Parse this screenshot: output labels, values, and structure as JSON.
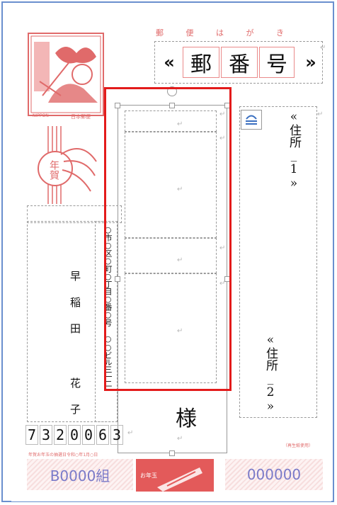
{
  "header": {
    "postcard_kana": "郵 便 は が き",
    "zip_left": "«",
    "zip_chars": [
      "郵",
      "番",
      "号"
    ],
    "zip_right": "»"
  },
  "stamp": {
    "caption_left": "NIPPON",
    "caption_right": "日本郵便"
  },
  "nenga": {
    "label": "年賀"
  },
  "sender": {
    "address": "○市○区○町○丁目○番○号 ○○ビル三一二",
    "name": "早稲田 花子"
  },
  "recipient": {
    "address_1": "«住所_1»",
    "address_2": "«住所_2»",
    "honorific": "様"
  },
  "sender_zip": [
    "7",
    "3",
    "2",
    "0",
    "0",
    "6",
    "3"
  ],
  "notes": {
    "left": "年賀お年玉の抽選日令和○年1月○日",
    "right": "（再生紙使用）"
  },
  "lottery": {
    "group": "B0000組",
    "number": "000000",
    "badge": "お年玉"
  },
  "colors": {
    "accent": "#e31b1b",
    "stamp": "#e06a6a",
    "lottery_text": "#7a7ac8"
  }
}
